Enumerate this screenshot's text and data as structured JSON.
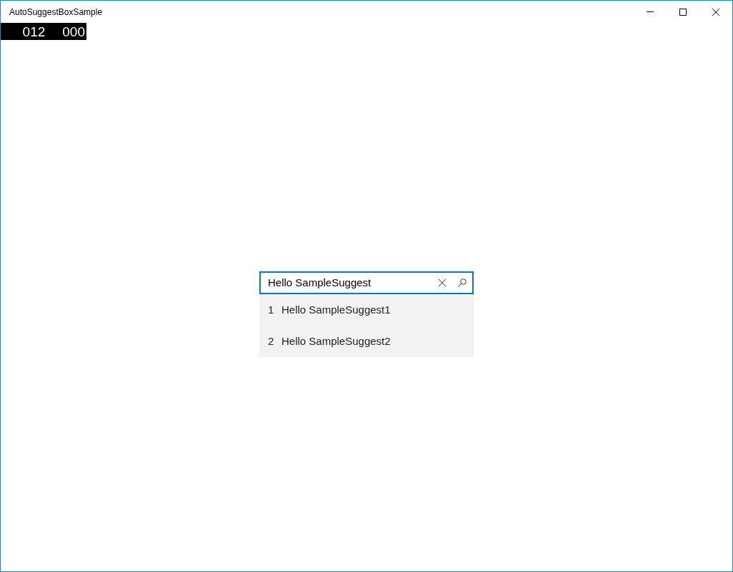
{
  "window": {
    "title": "AutoSuggestBoxSample"
  },
  "frame_counter": [
    "012",
    "000"
  ],
  "search": {
    "value": "Hello SampleSuggest"
  },
  "suggestions": [
    {
      "index": "1",
      "text": "Hello SampleSuggest1"
    },
    {
      "index": "2",
      "text": "Hello SampleSuggest2"
    }
  ]
}
